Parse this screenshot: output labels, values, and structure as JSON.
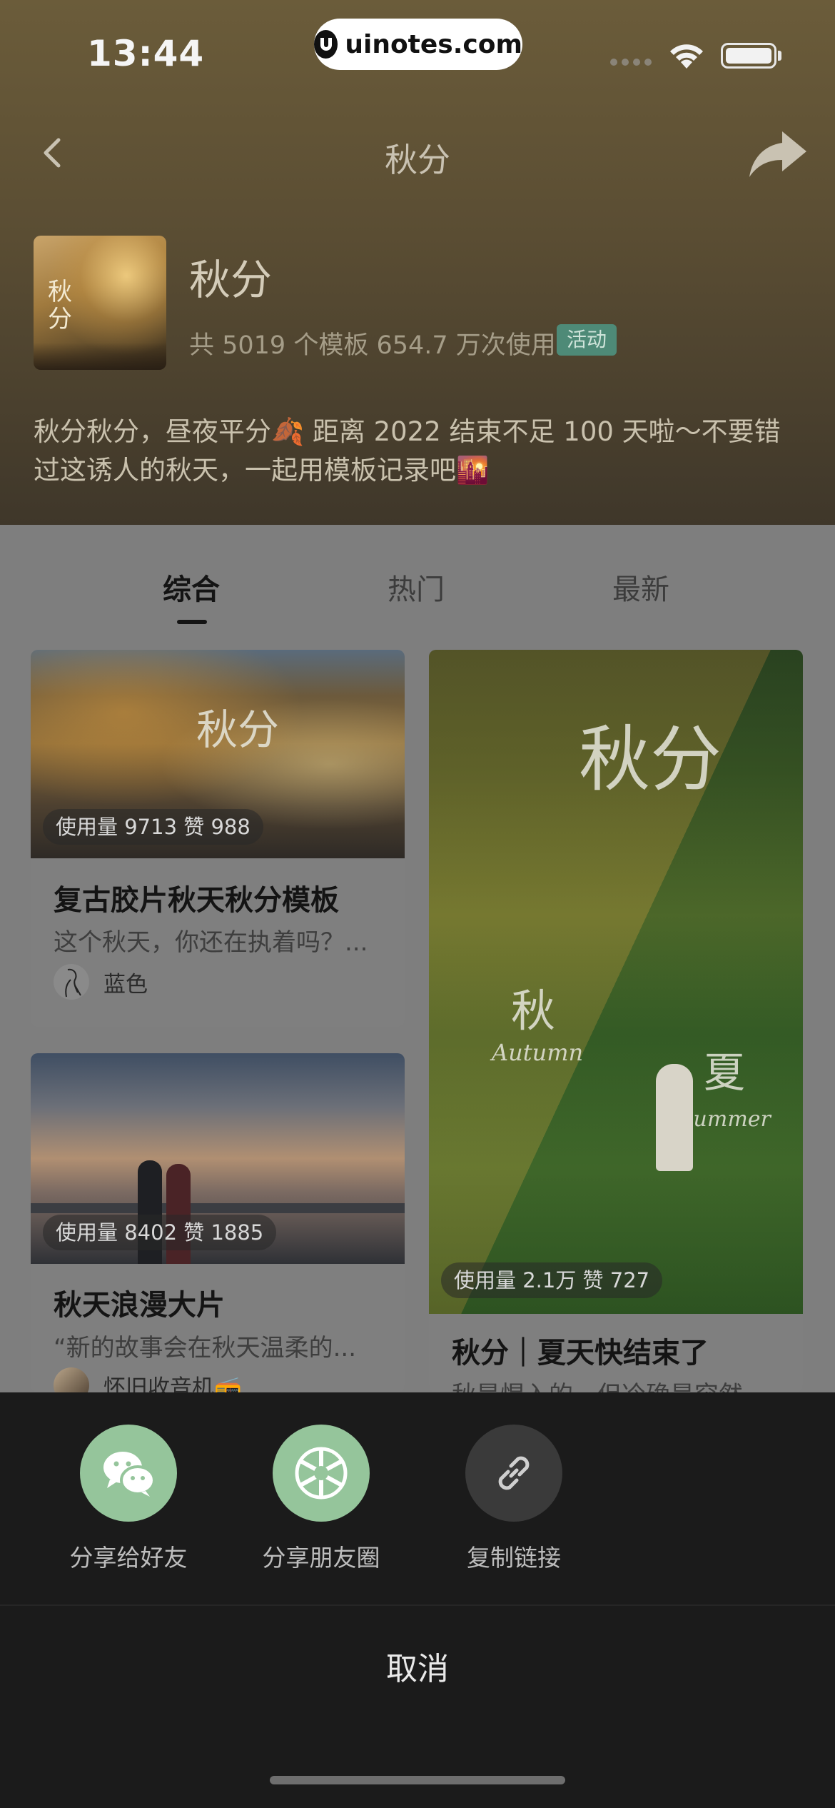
{
  "status_bar": {
    "time": "13:44",
    "pill_text": "uinotes.com"
  },
  "nav": {
    "title": "秋分"
  },
  "topic": {
    "name": "秋分",
    "stats": "共 5019 个模板 654.7 万次使用",
    "badge": "活动",
    "description": "秋分秋分，昼夜平分🍂 距离 2022 结束不足 100 天啦～不要错过这诱人的秋天，一起用模板记录吧🌇"
  },
  "tabs": [
    {
      "label": "综合",
      "active": true
    },
    {
      "label": "热门",
      "active": false
    },
    {
      "label": "最新",
      "active": false
    }
  ],
  "cards": [
    {
      "usage": "使用量 9713 赞 988",
      "title": "复古胶片秋天秋分模板",
      "subtitle": "这个秋天，你还在执着吗？...",
      "author": "蓝色"
    },
    {
      "usage": "使用量 8402 赞 1885",
      "title": "秋天浪漫大片",
      "subtitle": "“新的故事会在秋天温柔的...",
      "author": "怀旧收音机📻"
    },
    {
      "usage": "使用量 2.1万 赞 727",
      "title": "秋分｜夏天快结束了",
      "subtitle": "秋是惺入的，但冷确是突然"
    }
  ],
  "overlays": {
    "card1": "秋分",
    "card3_big": "秋分",
    "card3_left": "秋",
    "card3_left_en": "Autumn",
    "card3_right": "夏",
    "card3_right_en": "Summer"
  },
  "share_sheet": {
    "options": [
      {
        "label": "分享给好友",
        "icon": "wechat-icon"
      },
      {
        "label": "分享朋友圈",
        "icon": "moments-icon"
      },
      {
        "label": "复制链接",
        "icon": "link-icon"
      }
    ],
    "cancel": "取消"
  }
}
